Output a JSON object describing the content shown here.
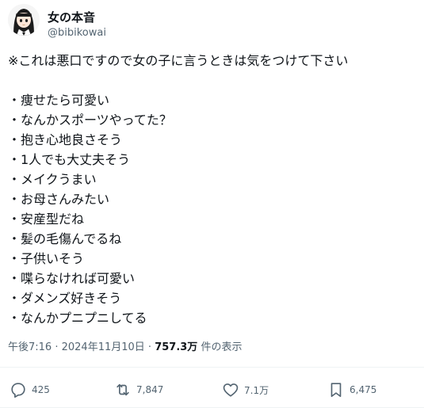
{
  "author": {
    "name": "女の本音",
    "handle": "@bibikowai"
  },
  "tweet": {
    "intro": "※これは悪口ですので女の子に言うときは気をつけて下さい",
    "items": [
      "・痩せたら可愛い",
      "・なんかスポーツやってた？",
      "・抱き心地良さそう",
      "・1人でも大丈夫そう",
      "・メイクうまい",
      "・お母さんみたい",
      "・安産型だね",
      "・髪の毛傷んでるね",
      "・子供いそう",
      "・喋らなければ可愛い",
      "・ダメンズ好きそう",
      "・なんかプニプニしてる"
    ]
  },
  "meta": {
    "time": "午後7:16",
    "date": "2024年11月10日",
    "views": "757.3万",
    "views_label": "件の表示"
  },
  "actions": {
    "replies": "425",
    "retweets": "7,847",
    "likes": "7.1万",
    "bookmarks": "6,475"
  }
}
